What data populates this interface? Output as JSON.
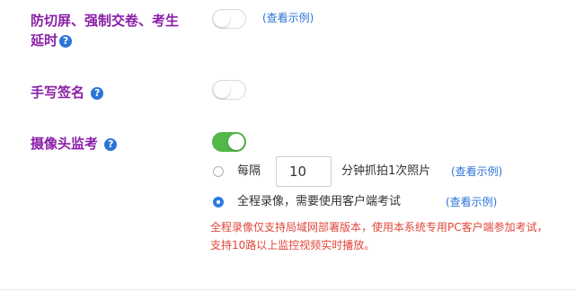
{
  "settings": {
    "anti_switch": {
      "label_line1": "防切屏、强制交卷、考生",
      "label_line2": "延时",
      "enabled": false,
      "example_link": "(查看示例)"
    },
    "signature": {
      "label": "手写签名",
      "enabled": false
    },
    "camera": {
      "label": "摄像头监考",
      "enabled": true,
      "options": {
        "interval": {
          "prefix": "每隔",
          "value": "10",
          "suffix": "分钟抓拍1次照片",
          "example_link": "(查看示例)",
          "selected": false
        },
        "recording": {
          "text": "全程录像，需要使用客户端考试",
          "example_link": "(查看示例)",
          "selected": true
        }
      },
      "warning": "全程录像仅支持局域网部署版本，使用本系统专用PC客户端参加考试，支持10路以上监控视频实时播放。"
    }
  },
  "help_icon_glyph": "?",
  "colors": {
    "label": "#8a1ea8",
    "link": "#2c74d6",
    "toggle_on": "#52b847",
    "radio_checked": "#2c7be5",
    "warning": "#e0463a"
  }
}
